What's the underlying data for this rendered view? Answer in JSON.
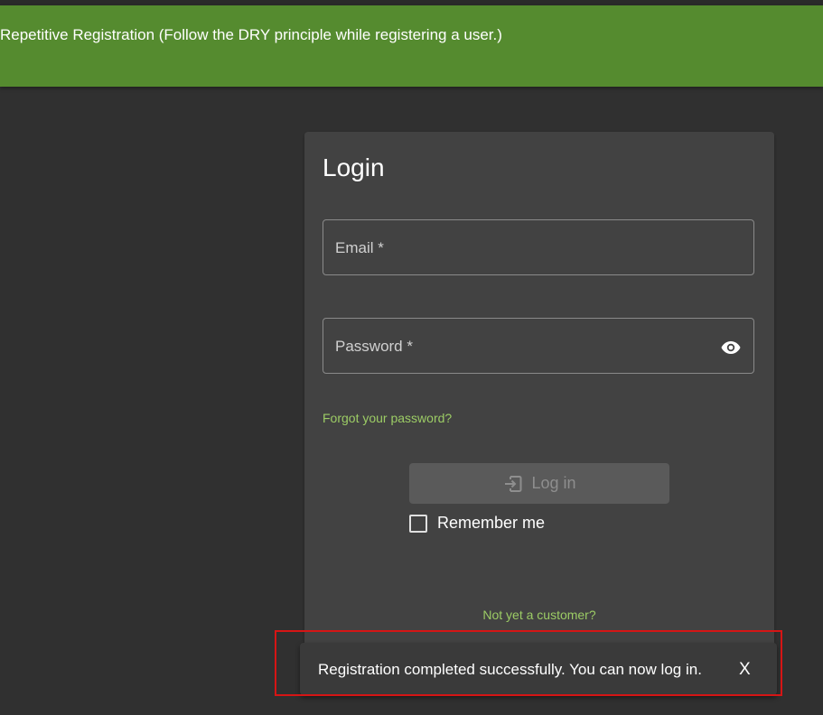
{
  "banner": {
    "text": "Repetitive Registration (Follow the DRY principle while registering a user.)"
  },
  "login_form": {
    "title": "Login",
    "email_label": "Email *",
    "password_label": "Password *",
    "forgot_password": "Forgot your password?",
    "login_button": "Log in",
    "remember_me": "Remember me",
    "signup_link": "Not yet a customer?"
  },
  "snackbar": {
    "message": "Registration completed successfully. You can now log in.",
    "close_label": "X"
  },
  "colors": {
    "background": "#303030",
    "banner": "#558b2f",
    "card": "#424242",
    "link": "#9ccc65",
    "highlight": "#d61515"
  },
  "icons": {
    "password_toggle": "eye-icon",
    "login_button": "login-icon"
  }
}
